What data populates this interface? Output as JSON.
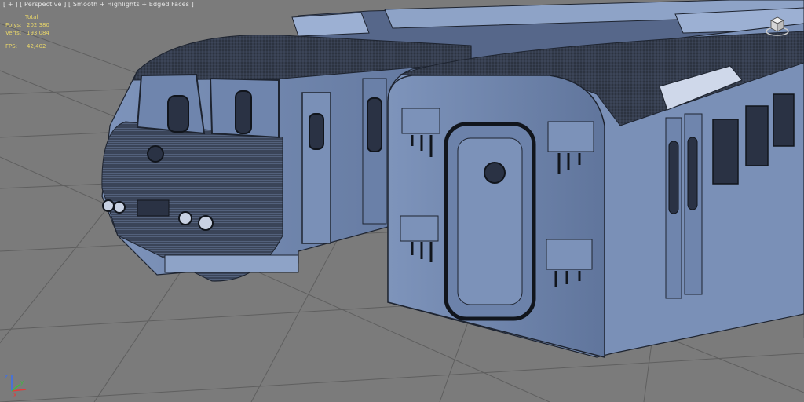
{
  "viewport_label": {
    "plus": "[ + ]",
    "view": "[ Perspective ]",
    "shading": "[ Smooth + Highlights + Edged Faces ]"
  },
  "stats": {
    "header": "Total",
    "polys_key": "Polys:",
    "polys_val": "202,380",
    "verts_key": "Verts:",
    "verts_val": "193,084",
    "fps_key": "FPS:",
    "fps_val": "42,402"
  },
  "colors": {
    "viewport_bg": "#7b7b7b",
    "model_face": "#6f85ad",
    "model_dark": "#1e2430",
    "stats_text": "#e8d66a"
  },
  "icons": {
    "viewcube": "viewcube-icon",
    "axis": "axis-tripod-icon"
  }
}
